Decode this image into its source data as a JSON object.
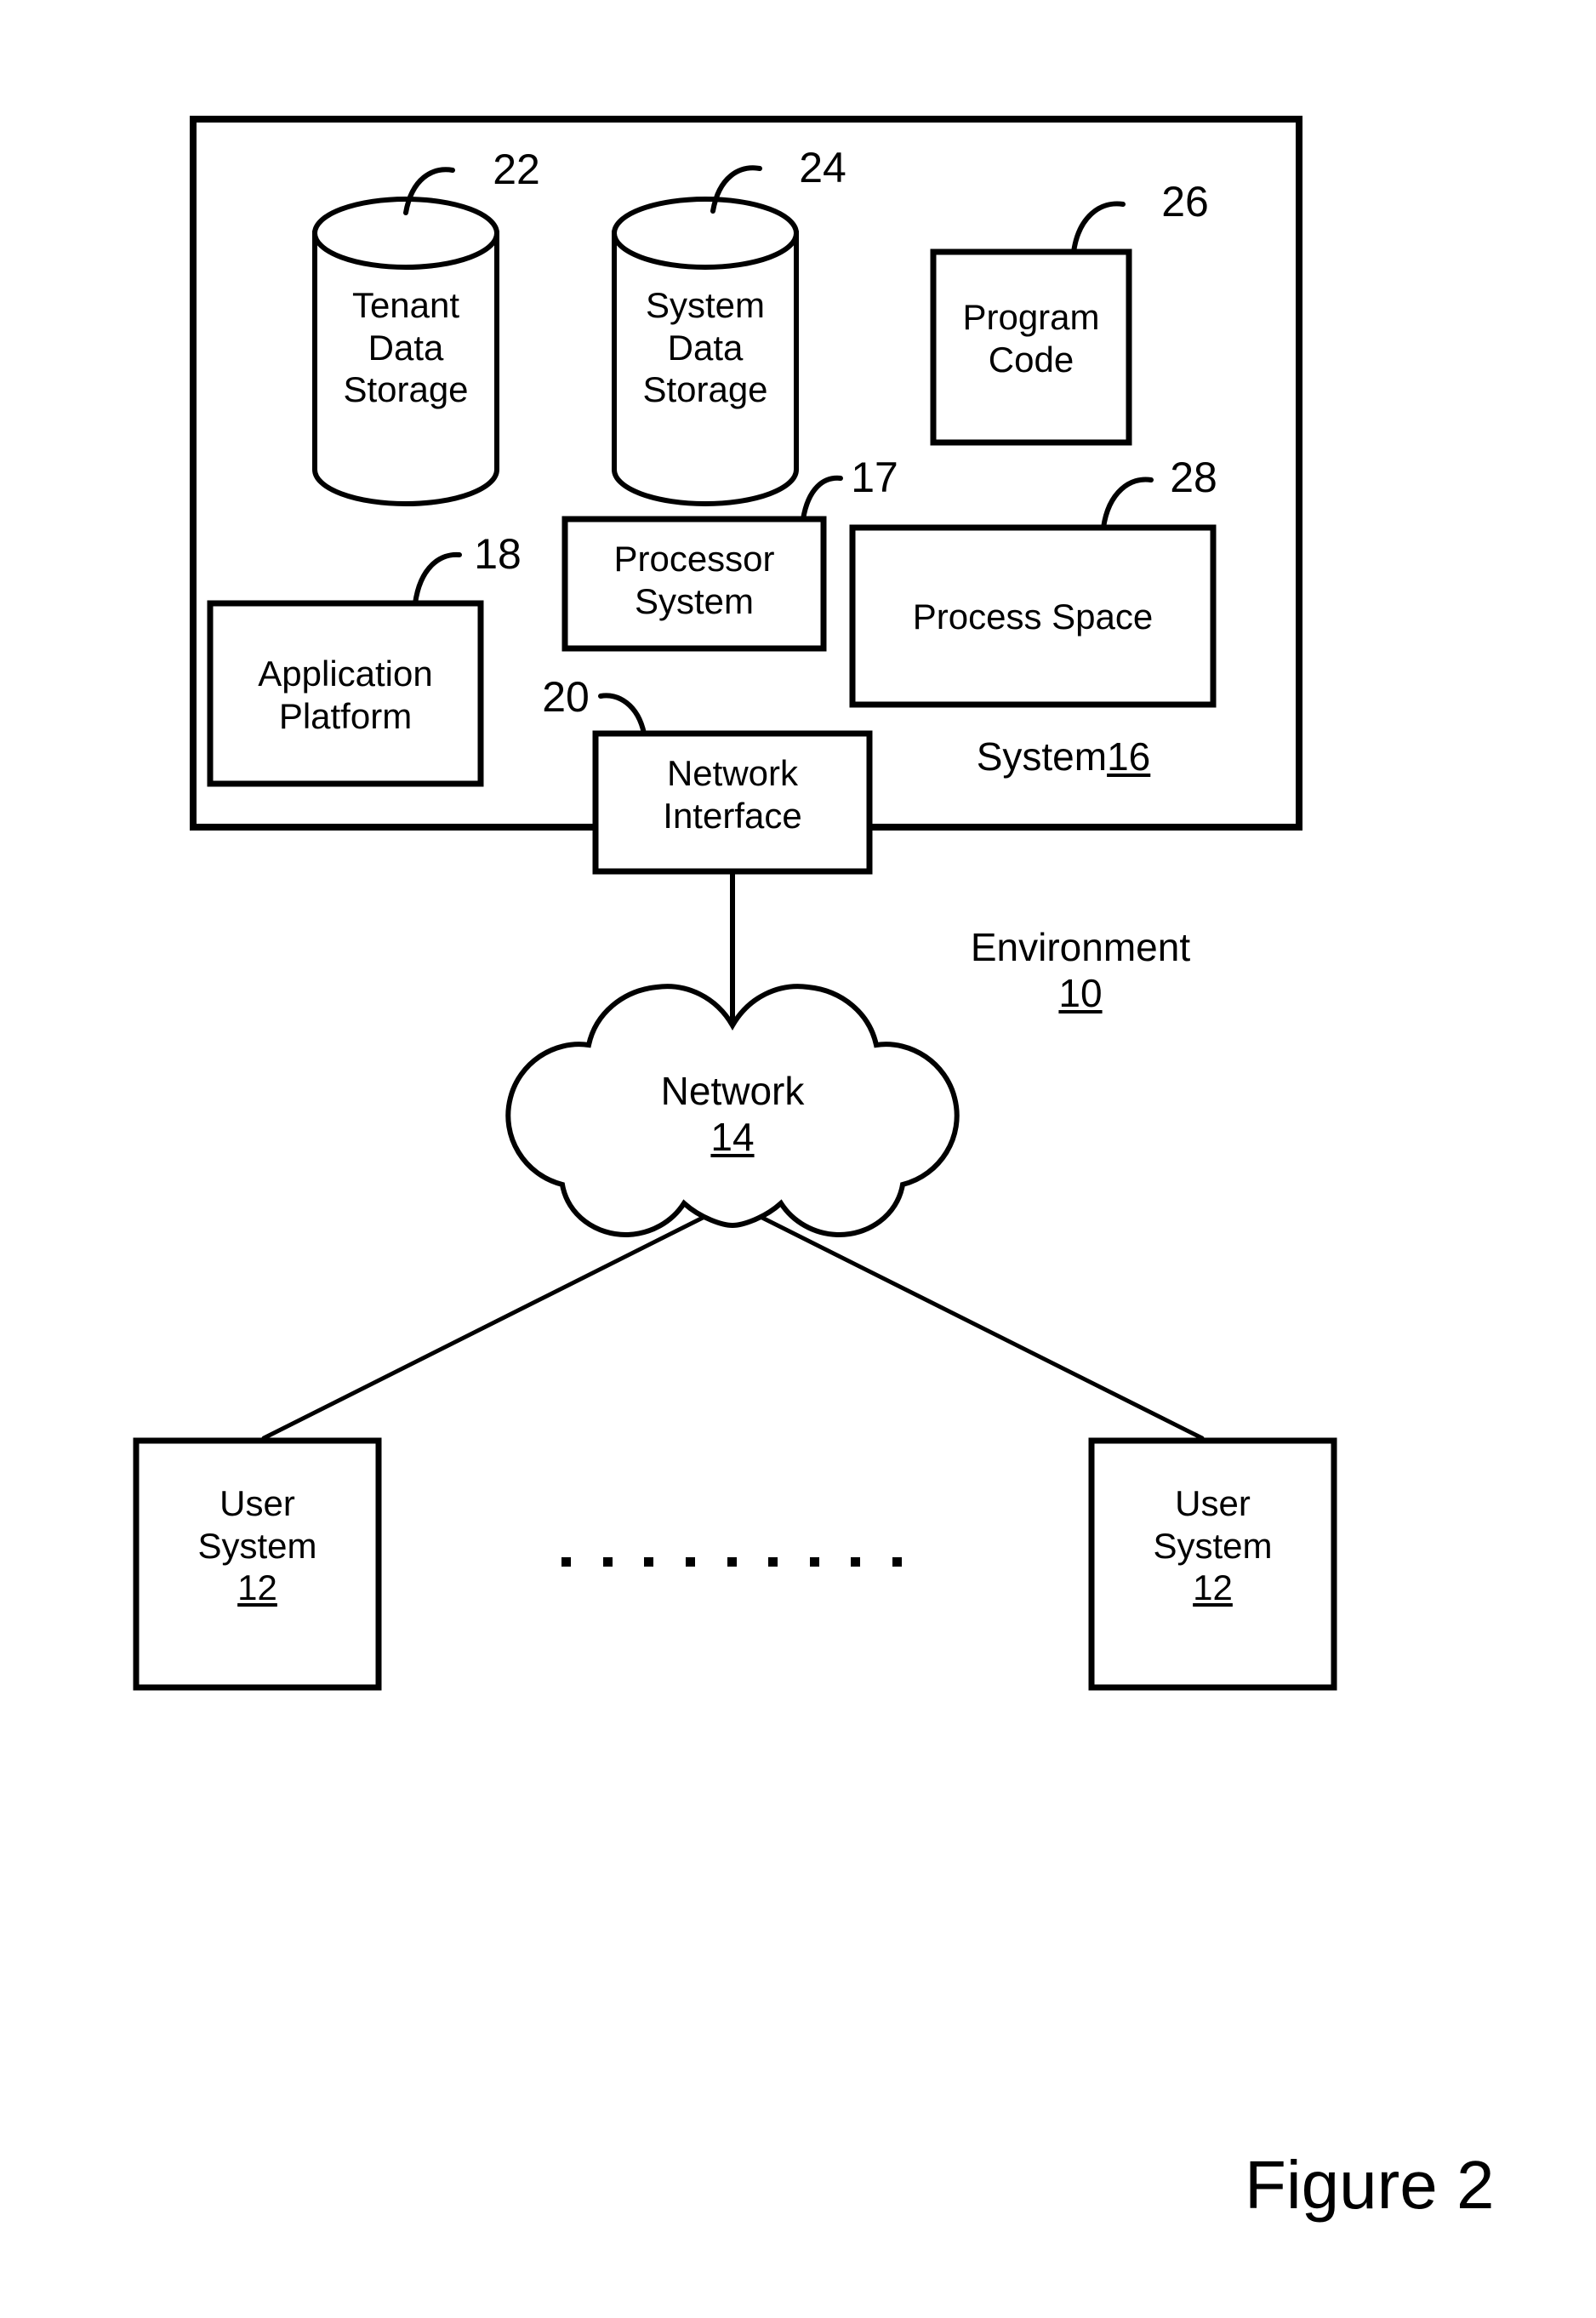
{
  "figure": {
    "caption": "Figure 2"
  },
  "diagram": {
    "type": "patent-block-diagram",
    "environment_label": "Environment",
    "environment_ref": "10",
    "system_label": "System",
    "system_ref": "16"
  },
  "system_box": {
    "ref": "16",
    "components": [
      {
        "id": "tenant-data-storage",
        "shape": "cylinder",
        "label_lines": [
          "Tenant",
          "Data",
          "Storage"
        ],
        "ref": "22"
      },
      {
        "id": "system-data-storage",
        "shape": "cylinder",
        "label_lines": [
          "System",
          "Data",
          "Storage"
        ],
        "ref": "24"
      },
      {
        "id": "program-code",
        "shape": "rect",
        "label_lines": [
          "Program",
          "Code"
        ],
        "ref": "26"
      },
      {
        "id": "processor-system",
        "shape": "rect",
        "label_lines": [
          "Processor",
          "System"
        ],
        "ref": "17"
      },
      {
        "id": "process-space",
        "shape": "rect",
        "label_lines": [
          "Process Space"
        ],
        "ref": "28"
      },
      {
        "id": "application-platform",
        "shape": "rect",
        "label_lines": [
          "Application",
          "Platform"
        ],
        "ref": "18"
      },
      {
        "id": "network-interface",
        "shape": "rect",
        "label_lines": [
          "Network",
          "Interface"
        ],
        "ref": "20"
      }
    ]
  },
  "network": {
    "shape": "cloud",
    "label": "Network",
    "ref": "14"
  },
  "user_systems": [
    {
      "id": "user-system-left",
      "label_lines": [
        "User",
        "System"
      ],
      "ref": "12"
    },
    {
      "id": "user-system-right",
      "label_lines": [
        "User",
        "System"
      ],
      "ref": "12"
    }
  ],
  "ellipsis": {
    "style": "dotted",
    "dot_count": 9
  },
  "text": {
    "tenant_l1": "Tenant",
    "tenant_l2": "Data",
    "tenant_l3": "Storage",
    "sysdata_l1": "System",
    "sysdata_l2": "Data",
    "sysdata_l3": "Storage",
    "progcode_l1": "Program",
    "progcode_l2": "Code",
    "proc_l1": "Processor",
    "proc_l2": "System",
    "procspace_l1": "Process Space",
    "appplat_l1": "Application",
    "appplat_l2": "Platform",
    "netif_l1": "Network",
    "netif_l2": "Interface",
    "env_l1": "Environment",
    "env_l2": "10",
    "sys_l1": "System",
    "sys_l2": "16",
    "net_l1": "Network",
    "net_l2": "14",
    "usr_l1": "User",
    "usr_l2": "System",
    "usr_l3": "12",
    "usr2_l1": "User",
    "usr2_l2": "System",
    "usr2_l3": "12",
    "ref22": "22",
    "ref24": "24",
    "ref26": "26",
    "ref17": "17",
    "ref28": "28",
    "ref18": "18",
    "ref20": "20",
    "caption": "Figure 2"
  },
  "colors": {
    "stroke": "#000000",
    "background": "#ffffff",
    "fill": "#ffffff"
  }
}
